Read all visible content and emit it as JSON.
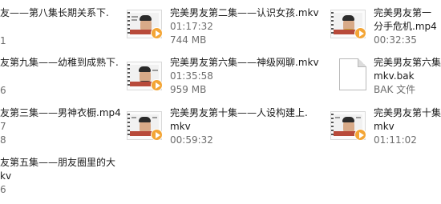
{
  "files": {
    "c0r0": {
      "name": "友——第八集长期关系下.",
      "meta1": "1"
    },
    "c0r1": {
      "name": "友第九集——幼稚到成熟下.",
      "meta1": "6"
    },
    "c0r2": {
      "name": "友第三集——男神衣橱.mp4",
      "meta1": "7",
      "meta2": "8"
    },
    "c0r3": {
      "name1": "友第五集——朋友圈里的大",
      "name2": "kv",
      "meta1": "6"
    },
    "c1r0": {
      "name": "完美男友第二集——认识女孩.mkv",
      "meta1": "01:17:32",
      "meta2": "744 MB"
    },
    "c1r1": {
      "name": "完美男友第六集——神级网聊.mkv",
      "meta1": "01:35:58",
      "meta2": "959 MB"
    },
    "c1r2": {
      "name1": "完美男友第十集——人设构建上.",
      "name2": "mkv",
      "meta1": "00:59:32"
    },
    "c2r0": {
      "name1": "完美男友第一",
      "name2": "分手危机.mp4",
      "meta1": "00:32:35"
    },
    "c2r1": {
      "name1": "完美男友第六集",
      "name2": "mkv.bak",
      "meta1": "BAK 文件"
    },
    "c2r2": {
      "name1": "完美男友第十集",
      "name2": "mkv",
      "meta1": "01:11:02"
    }
  },
  "icons": {
    "video_thumbnail": "video-thumbnail-icon",
    "play_badge": "play-badge-icon",
    "generic_file": "document-icon"
  },
  "colors": {
    "play_badge": "#f3a536",
    "meta_text": "#6d6d6d",
    "name_text": "#1a1a1a"
  }
}
